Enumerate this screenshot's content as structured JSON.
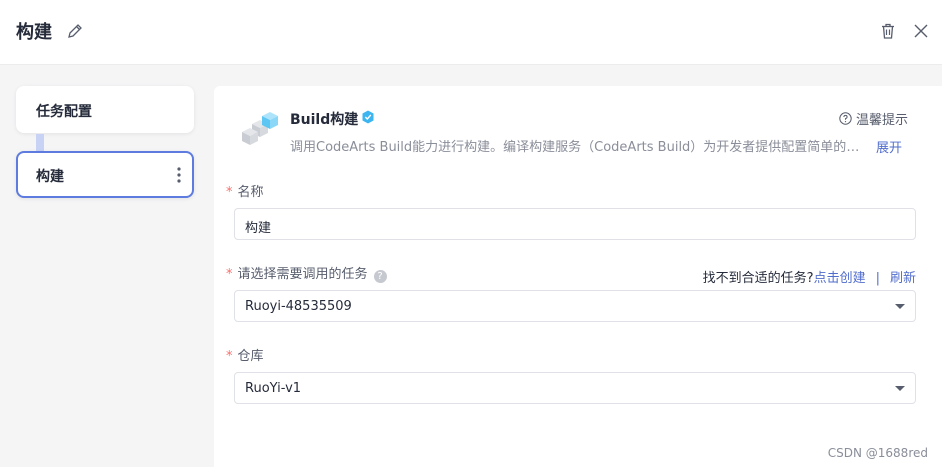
{
  "header": {
    "title": "构建"
  },
  "stages": [
    {
      "label": "任务配置"
    },
    {
      "label": "构建"
    }
  ],
  "plugin": {
    "name": "Build构建",
    "tips": "温馨提示",
    "description": "调用CodeArts Build能力进行构建。编译构建服务（CodeArts Build）为开发者提供配置简单的混合语言构建平台，实现编译构建云端化。",
    "expand": "展开"
  },
  "form": {
    "name_label": "名称",
    "name_value": "构建",
    "task_label": "请选择需要调用的任务",
    "task_hint": "找不到合适的任务?",
    "task_create": "点击创建",
    "task_sep": "|",
    "task_refresh": "刷新",
    "task_value": "Ruoyi-48535509",
    "repo_label": "仓库",
    "repo_value": "RuoYi-v1"
  },
  "watermark": "CSDN @1688red",
  "colors": {
    "accent": "#5e7ce0",
    "link": "#526ecc",
    "required": "#f66f6a"
  }
}
